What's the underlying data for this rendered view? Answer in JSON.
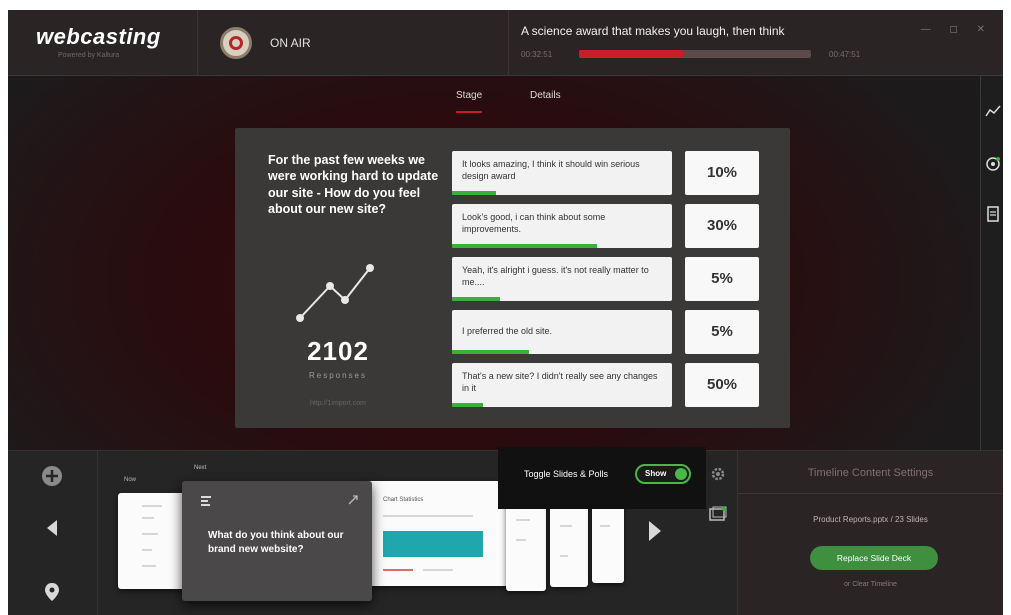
{
  "header": {
    "logo": "webcasting",
    "logo_sub": "Powered by Kaltura",
    "status": "ON AIR",
    "now_title": "A science award that makes you laugh, then think",
    "time_start": "00:32:51",
    "time_end": "00:47:51",
    "progress": 0.45
  },
  "tabs": [
    "Stage",
    "Details"
  ],
  "poll": {
    "question": "For the past few weeks we were working hard to update our site - How do you feel about our new site?",
    "responses_count": "2102",
    "responses_label": "Responses",
    "url": "http://1import.com",
    "answers": [
      {
        "text": "It looks amazing, I think it should win serious design award",
        "percent": "10%",
        "fill": 0.2
      },
      {
        "text": "Look's good, i can think about some improvements.",
        "percent": "30%",
        "fill": 0.66
      },
      {
        "text": "Yeah, it's alright i guess. it's not really matter to me....",
        "percent": "5%",
        "fill": 0.22
      },
      {
        "text": "I preferred the old site.",
        "percent": "5%",
        "fill": 0.35
      },
      {
        "text": "That's a new site? I didn't really see any changes in it",
        "percent": "50%",
        "fill": 0.14
      }
    ]
  },
  "bottom": {
    "now_label": "Now",
    "next_label": "Next",
    "next_card_text": "What do you think about our brand new website?",
    "chart_slide_title": "Chart Statistics",
    "toggle_label": "Toggle Slides & Polls",
    "toggle_state": "Show"
  },
  "timeline": {
    "title": "Timeline Content Settings",
    "file": "Product Reports.pptx / 23 Slides",
    "replace_button": "Replace Slide Deck",
    "clear_link": "or Clear Timeline"
  },
  "colors": {
    "accent": "#c61f27",
    "success": "#3ab03a",
    "panel": "#3b3838"
  }
}
